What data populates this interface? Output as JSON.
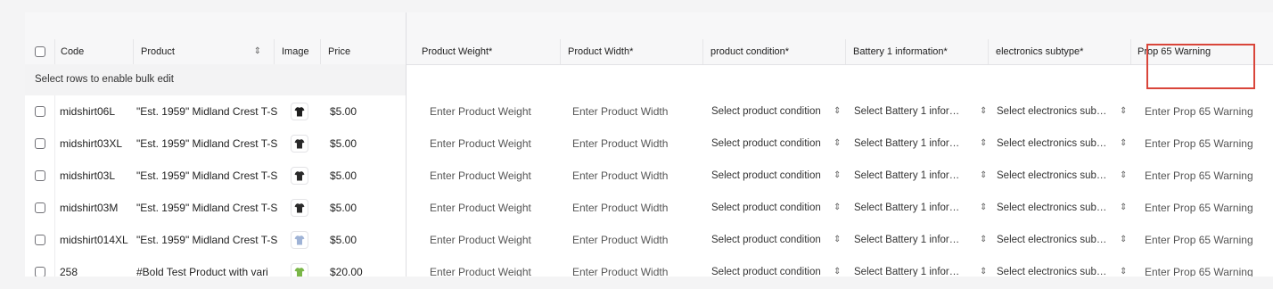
{
  "columns": {
    "code": "Code",
    "product": "Product",
    "image": "Image",
    "price": "Price",
    "product_weight": "Product Weight*",
    "product_width": "Product Width*",
    "product_condition": "product condition*",
    "battery_info": "Battery 1 information*",
    "electronics_subtype": "electronics subtype*",
    "prop65": "Prop 65 Warning"
  },
  "bulk_edit_hint": "Select rows to enable bulk edit",
  "placeholders": {
    "product_weight": "Enter Product Weight",
    "product_width": "Enter Product Width",
    "product_condition": "Select product condition",
    "battery_info": "Select Battery 1 infor…",
    "electronics_subtype": "Select electronics sub…",
    "prop65": "Enter Prop 65 Warning"
  },
  "rows": [
    {
      "code": "midshirt06L",
      "product": "\"Est. 1959\" Midland Crest T-S",
      "price": "$5.00",
      "image_color": "#1e1e1e"
    },
    {
      "code": "midshirt03XL",
      "product": "\"Est. 1959\" Midland Crest T-S",
      "price": "$5.00",
      "image_color": "#2a2a2a"
    },
    {
      "code": "midshirt03L",
      "product": "\"Est. 1959\" Midland Crest T-S",
      "price": "$5.00",
      "image_color": "#2a2a2a"
    },
    {
      "code": "midshirt03M",
      "product": "\"Est. 1959\" Midland Crest T-S",
      "price": "$5.00",
      "image_color": "#2a2a2a"
    },
    {
      "code": "midshirt014XL",
      "product": "\"Est. 1959\" Midland Crest T-S",
      "price": "$5.00",
      "image_color": "#9fb3d6"
    },
    {
      "code": "258",
      "product": "#Bold Test Product with vari",
      "price": "$20.00",
      "image_color": "#7ab648"
    }
  ],
  "colors": {
    "highlight": "#d9453a",
    "frozen_background": "#f3f3f4",
    "header_background": "#f7f7f8"
  },
  "icons": {
    "sort": "sort-updown-icon",
    "select_chevron": "chevron-updown-icon",
    "thumbnail": "tshirt-icon"
  }
}
